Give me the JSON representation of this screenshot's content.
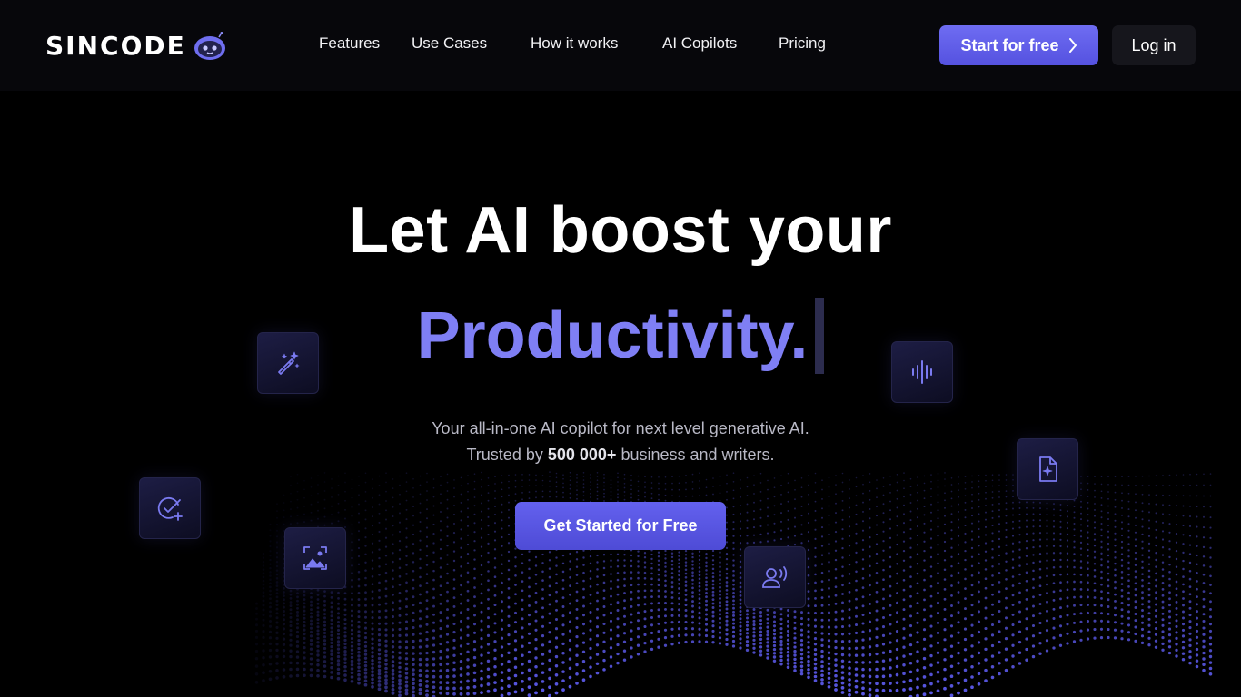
{
  "brand": {
    "name": "SINCODE",
    "logo_icon": "robot-icon"
  },
  "nav": {
    "items": [
      {
        "label": "Features"
      },
      {
        "label": "Use Cases"
      },
      {
        "label": "How it works"
      },
      {
        "label": "AI Copilots"
      },
      {
        "label": "Pricing"
      }
    ]
  },
  "header_actions": {
    "start_label": "Start for free",
    "start_icon": "chevron-right-icon",
    "login_label": "Log in"
  },
  "hero": {
    "title": "Let AI boost your",
    "accent": "Productivity.",
    "subtitle_line1": "Your all-in-one AI copilot for next level generative AI.",
    "subtitle_line2_prefix": "Trusted by",
    "subtitle_line2_bold": "500 000+",
    "subtitle_line2_suffix": "business and writers.",
    "cta_label": "Get Started for Free"
  },
  "feature_icons": [
    "magic-wand-icon",
    "audio-wave-icon",
    "document-sparkle-icon",
    "check-add-icon",
    "image-icon",
    "voice-user-icon"
  ],
  "colors": {
    "background": "#000000",
    "accent": "#7f7ff4",
    "button": "#5b59e8",
    "icon": "#7a7af0"
  }
}
